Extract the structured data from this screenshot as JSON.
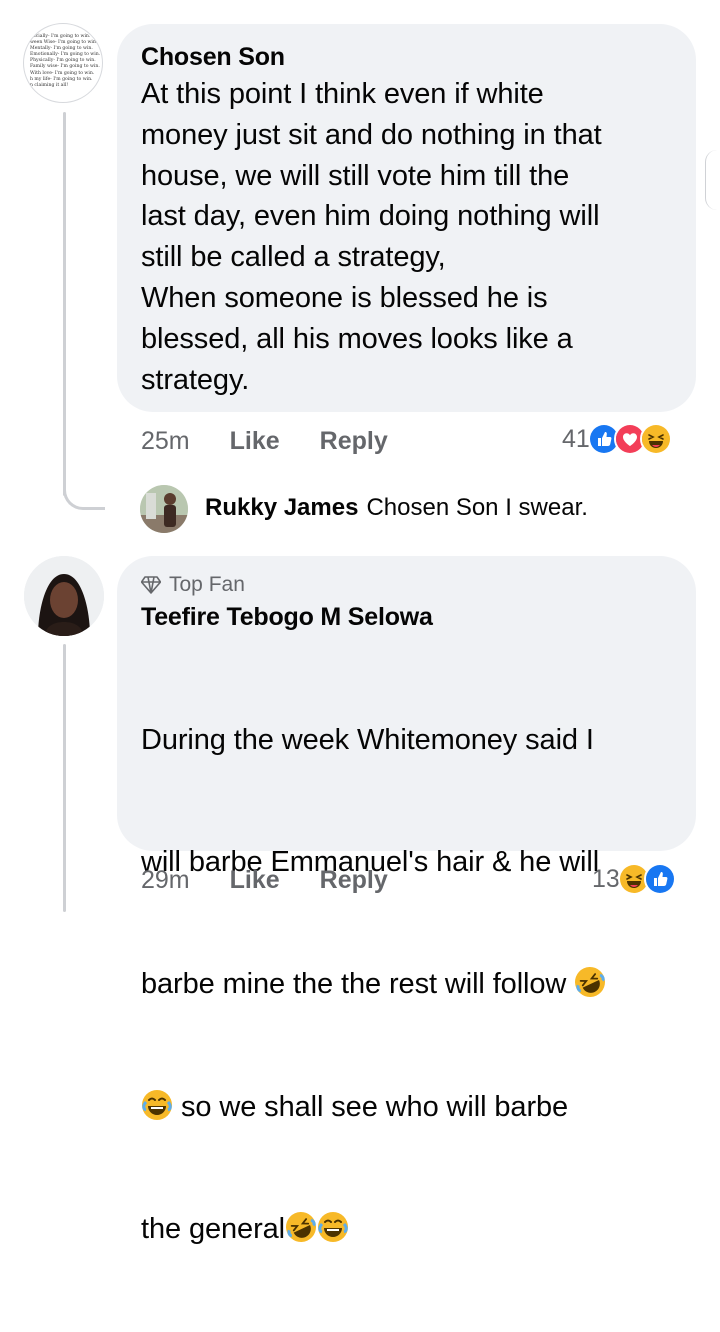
{
  "comments": [
    {
      "author": "Chosen Son",
      "avatar_text": [
        "ancially- I'm going to win.",
        "ween Wise- I'm going to win.",
        "Mentally- I'm going to win.",
        "Emotionally- I'm going to win.",
        "Physically- I'm going to win.",
        "Family wise- I'm going to win.",
        "With love- I'm going to win.",
        "h my life- I'm going to win.",
        "n claiming it all!"
      ],
      "text": "At this point I think even if white\nmoney just sit and do nothing in that\nhouse, we will still vote him till the\nlast day, even him doing nothing will\nstill be called a strategy,\nWhen someone is blessed he is\nblessed, all his moves looks like a\nstrategy.",
      "time": "25m",
      "like_label": "Like",
      "reply_label": "Reply",
      "reaction_count": "41",
      "reactions": [
        "like-icon",
        "love-icon",
        "haha-icon"
      ]
    },
    {
      "badge": "Top Fan",
      "author": "Teefire Tebogo M Selowa",
      "text_lines": [
        "During the week Whitemoney said I",
        "will barbe Emmanuel's hair & he will",
        "barbe mine the the rest will follow",
        "so we shall see who will barbe",
        "the general"
      ],
      "time": "29m",
      "like_label": "Like",
      "reply_label": "Reply",
      "reaction_count": "13",
      "reactions": [
        "haha-icon",
        "like-icon"
      ]
    }
  ],
  "reply_preview": {
    "author": "Rukky James",
    "text": "Chosen Son I swear."
  },
  "colors": {
    "bubble": "#f0f2f5",
    "muted": "#65676b",
    "like_blue": "#1877f2",
    "love_red": "#f33e58",
    "haha_yellow": "#f7b928"
  }
}
